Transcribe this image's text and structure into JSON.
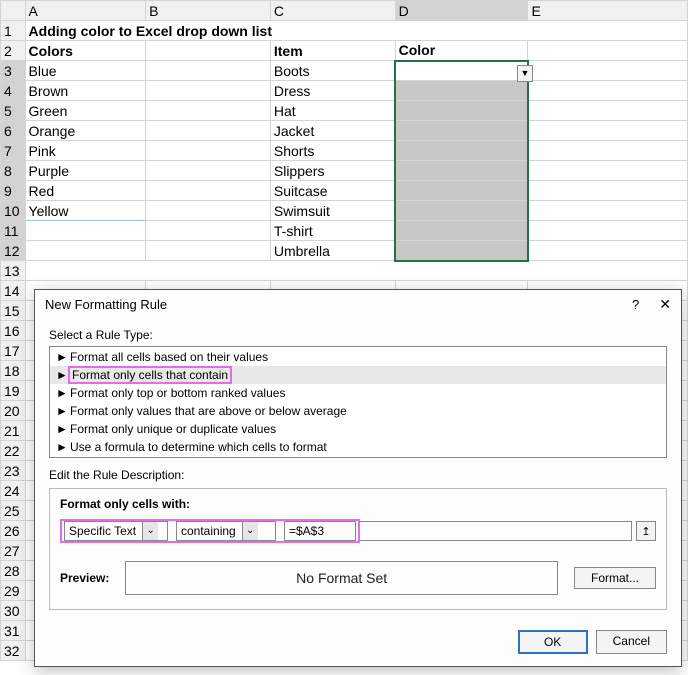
{
  "title": "Adding color to Excel drop down list",
  "headers": {
    "A": "Colors",
    "C": "Item",
    "D": "Color"
  },
  "colors": [
    "Blue",
    "Brown",
    "Green",
    "Orange",
    "Pink",
    "Purple",
    "Red",
    "Yellow"
  ],
  "items": [
    "Boots",
    "Dress",
    "Hat",
    "Jacket",
    "Shorts",
    "Slippers",
    "Suitcase",
    "Swimsuit",
    "T-shirt",
    "Umbrella"
  ],
  "dialog": {
    "title": "New Formatting Rule",
    "help": "?",
    "selectLabel": "Select a Rule Type:",
    "rules": [
      "Format all cells based on their values",
      "Format only cells that contain",
      "Format only top or bottom ranked values",
      "Format only values that are above or below average",
      "Format only unique or duplicate values",
      "Use a formula to determine which cells to format"
    ],
    "descLabel": "Edit the Rule Description:",
    "formatWith": "Format only cells with:",
    "combo1": "Specific Text",
    "combo2": "containing",
    "formula": "=$A$3",
    "previewLabel": "Preview:",
    "previewText": "No Format Set",
    "formatBtn": "Format...",
    "ok": "OK",
    "cancel": "Cancel"
  }
}
